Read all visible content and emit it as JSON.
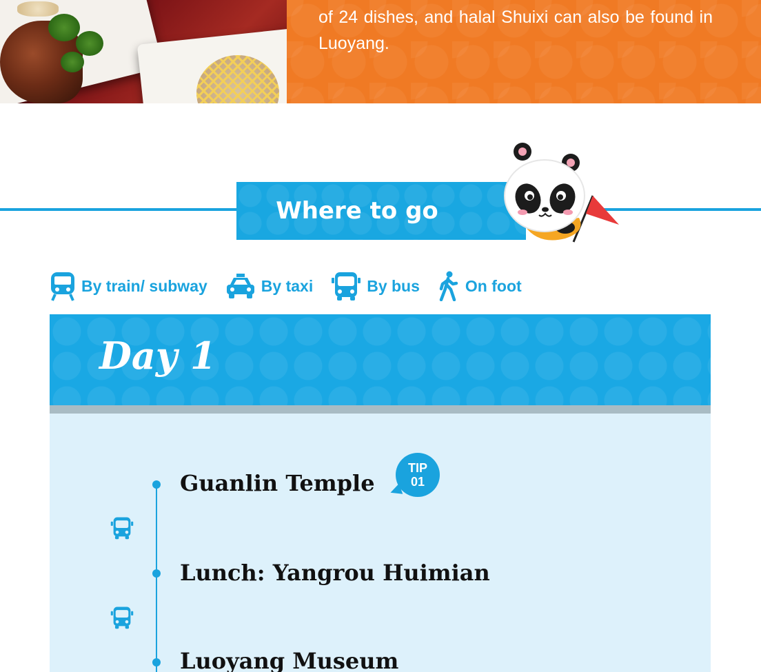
{
  "intro": {
    "text": "of 24 dishes, and halal Shuixi can also be found in Luoyang."
  },
  "section": {
    "title": "Where to go"
  },
  "legend": [
    {
      "icon": "train-icon",
      "label": "By train/ subway"
    },
    {
      "icon": "taxi-icon",
      "label": "By taxi"
    },
    {
      "icon": "bus-icon",
      "label": "By bus"
    },
    {
      "icon": "walk-icon",
      "label": "On foot"
    }
  ],
  "day": {
    "title": "Day 1"
  },
  "stops": [
    {
      "name": "Guanlin Temple",
      "tip": {
        "line1": "TIP",
        "line2": "01"
      }
    },
    {
      "name": "Lunch: Yangrou Huimian"
    },
    {
      "name": "Luoyang Museum"
    }
  ],
  "transport": [
    "bus-icon",
    "bus-icon"
  ],
  "colors": {
    "accent_blue": "#1aa3de",
    "orange": "#f07a24",
    "light_blue_bg": "#ddf1fb"
  }
}
